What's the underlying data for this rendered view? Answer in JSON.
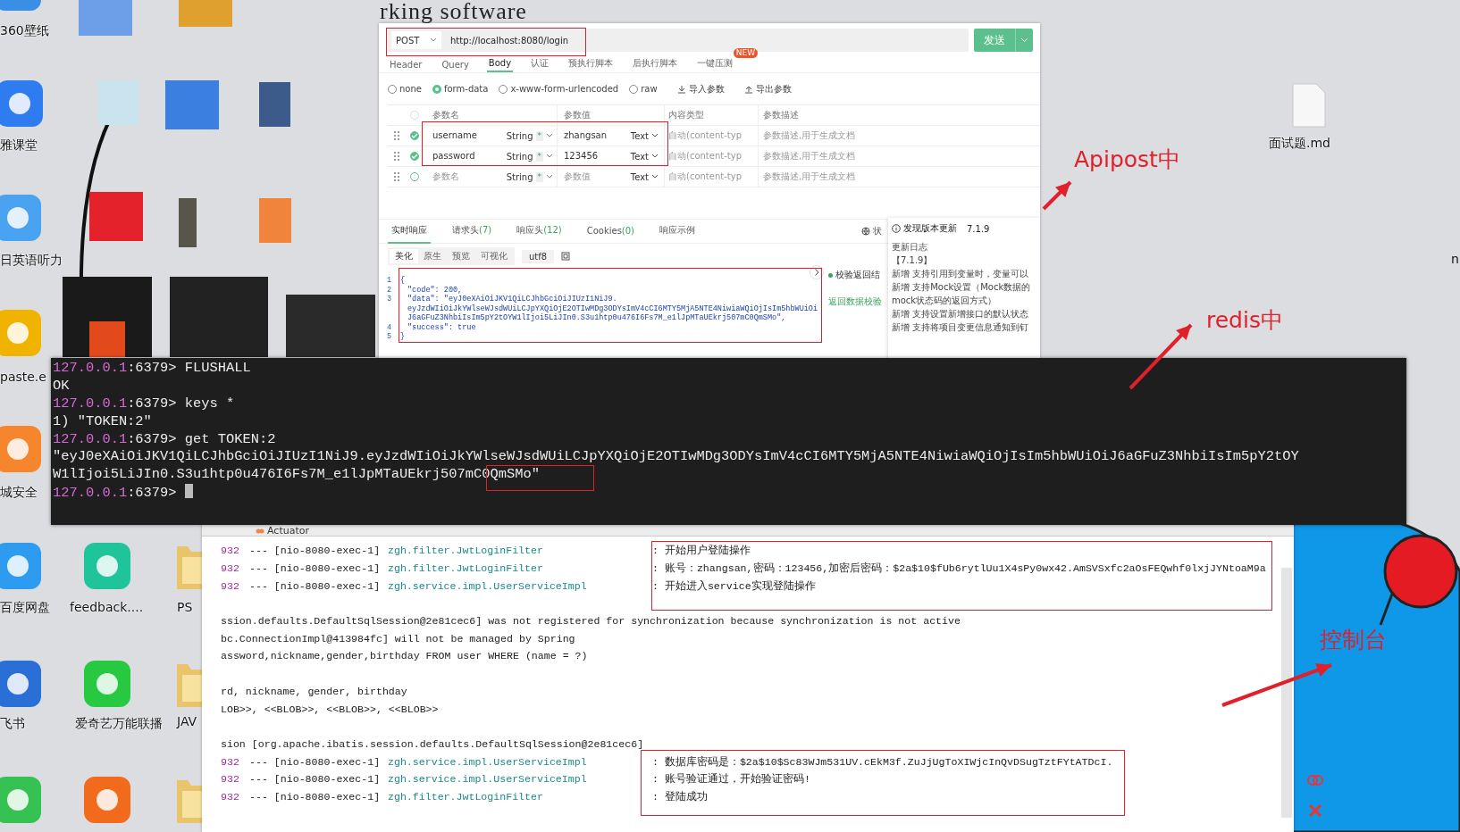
{
  "desktop": {
    "wallpaper_text": "rking software",
    "edge_text": "n",
    "icons": [
      {
        "kind": "app",
        "label": "360壁纸"
      },
      {
        "kind": "app",
        "label": "雅课堂"
      },
      {
        "kind": "app",
        "label": "日英语听力"
      },
      {
        "kind": "app",
        "label": "paste.e"
      },
      {
        "kind": "app",
        "label": "城安全"
      },
      {
        "kind": "app",
        "label": "百度网盘"
      },
      {
        "kind": "app",
        "label": "飞书"
      },
      {
        "kind": "app"
      },
      {
        "kind": "app",
        "label": "feedback...."
      },
      {
        "kind": "app",
        "label": "爱奇艺万能联播"
      },
      {
        "kind": "app"
      },
      {
        "kind": "folder",
        "label": "PS"
      },
      {
        "kind": "folder",
        "label": "JAV"
      },
      {
        "kind": "folder"
      },
      {
        "kind": "file",
        "label": "面试题.md"
      }
    ]
  },
  "annotations": [
    {
      "text": "Apipost中"
    },
    {
      "text": "redis中"
    },
    {
      "text": "控制台"
    }
  ],
  "apipost": {
    "method": "POST",
    "url": "http://localhost:8080/login",
    "send": "发送",
    "tabs": [
      {
        "label": "Header",
        "selected": false
      },
      {
        "label": "Query",
        "selected": false
      },
      {
        "label": "Body",
        "selected": true
      },
      {
        "label": "认证",
        "selected": false
      },
      {
        "label": "预执行脚本",
        "selected": false
      },
      {
        "label": "后执行脚本",
        "selected": false
      },
      {
        "label": "一键压测",
        "selected": false,
        "badge": "NEW"
      }
    ],
    "body_types": [
      {
        "label": "none",
        "selected": false
      },
      {
        "label": "form-data",
        "selected": true
      },
      {
        "label": "x-www-form-urlencoded",
        "selected": false
      },
      {
        "label": "raw",
        "selected": false
      }
    ],
    "actions": [
      {
        "label": "导入参数",
        "kind": "import"
      },
      {
        "label": "导出参数",
        "kind": "export"
      }
    ],
    "select_all": {
      "checked": false
    },
    "columns": [
      "参数名",
      "参数值",
      "内容类型",
      "参数描述"
    ],
    "rows": [
      {
        "checked": true,
        "name": "username",
        "type": "String",
        "required": "*",
        "value": "zhangsan",
        "content_type": "Text",
        "content_hint": "自动(content-typ",
        "description": "参数描述,用于生成文档"
      },
      {
        "checked": true,
        "name": "password",
        "type": "String",
        "required": "*",
        "value": "123456",
        "content_type": "Text",
        "content_hint": "自动(content-typ",
        "description": "参数描述,用于生成文档"
      },
      {
        "checked": false,
        "name_placeholder": "参数名",
        "type": "String",
        "required": "*",
        "value_placeholder": "参数值",
        "content_type": "Text",
        "content_hint": "自动(content-typ",
        "description": "参数描述,用于生成文档"
      }
    ],
    "response_tabs": [
      {
        "label": "实时响应",
        "selected": true
      },
      {
        "label": "请求头",
        "count": "(7)",
        "selected": false
      },
      {
        "label": "响应头",
        "count": "(12)",
        "selected": false
      },
      {
        "label": "Cookies",
        "count": "(0)",
        "selected": false
      },
      {
        "label": "响应示例",
        "selected": false
      }
    ],
    "status_label": "状",
    "view_tabs": [
      {
        "label": "美化",
        "selected": true
      },
      {
        "label": "原生",
        "selected": false
      },
      {
        "label": "预览",
        "selected": false
      },
      {
        "label": "可视化",
        "selected": false
      }
    ],
    "encoding": "utf8",
    "code_lines": [
      {
        "number": "1",
        "text": "{"
      },
      {
        "number": "2",
        "text": "\"code\": 200,"
      },
      {
        "number": "3",
        "text": "\"data\": \"eyJ0eXAiOiJKV1QiLCJhbGciOiJIUzI1NiJ9."
      },
      {
        "text": "eyJzdWIiOiJkYWlseWJsdWUiLCJpYXQiOjE2OTIwMDg3ODYsImV4cCI6MTY5MjA5NTE4NiwiaWQiOjIsIm5hbWUiOi"
      },
      {
        "text": "J6aGFuZ3NhbiIsIm5pY2tOYW1lIjoi5LiJIn0.S3u1htp0u476I6Fs7M_e1lJpMTaUEkrj507mC0QmSMo\","
      },
      {
        "number": "4",
        "text": "\"success\": true"
      },
      {
        "number": "5",
        "text": "}"
      }
    ],
    "validate_label": "校验返回结",
    "validate_link": "返回数据校验",
    "update": {
      "title": "发现版本更新",
      "version": "7.1.9",
      "log_title": "更新日志",
      "log_version": "【7.1.9】",
      "items": [
        "新增 支持引用到变量时，变量可以",
        "新增 支持Mock设置（Mock数据的",
        "mock状态码的返回方式）",
        "新增 支持设置新增接口的默认状态",
        "新增 支持将项目变更信息通知到钉"
      ]
    }
  },
  "terminal": {
    "lines": [
      {
        "kind": "prompt",
        "host": "127.0.0.1",
        "rest": ":6379> FLUSHALL"
      },
      {
        "kind": "output",
        "text": "OK"
      },
      {
        "kind": "prompt",
        "host": "127.0.0.1",
        "rest": ":6379> keys *"
      },
      {
        "kind": "output",
        "text": "1) \"TOKEN:2\""
      },
      {
        "kind": "prompt",
        "host": "127.0.0.1",
        "rest": ":6379> get TOKEN:2"
      },
      {
        "kind": "output",
        "text": "\"eyJ0eXAiOiJKV1QiLCJhbGciOiJIUzI1NiJ9.eyJzdWIiOiJkYWlseWJsdWUiLCJpYXQiOjE2OTIwMDg3ODYsImV4cCI6MTY5MjA5NTE4NiwiaWQiOjIsIm5hbWUiOiJ6aGFuZ3NhbiIsIm5pY2tOY"
      },
      {
        "kind": "output",
        "text": "W1lIjoi5LiJIn0.S3u1htp0u476I6Fs7M_e1lJpMTaUEkrj507mC0QmSMo\""
      },
      {
        "kind": "prompt",
        "host": "127.0.0.1",
        "rest": ":6379> ",
        "cursor": true
      }
    ]
  },
  "console": {
    "tab": "Actuator",
    "lines": [
      {
        "kind": "log",
        "pid": "932",
        "thread": "--- [nio-8080-exec-1]",
        "logger": "zgh.filter.JwtLoginFilter",
        "message": ": 开始用户登陆操作"
      },
      {
        "kind": "log",
        "pid": "932",
        "thread": "--- [nio-8080-exec-1]",
        "logger": "zgh.filter.JwtLoginFilter",
        "message": ": 账号：zhangsan,密码：123456,加密后密码：$2a$10$fUb6rytlUu1X4sPy0wx42.AmSVSxfc2aOsFEQwhf0lxjJYNtoaM9a"
      },
      {
        "kind": "log",
        "pid": "932",
        "thread": "--- [nio-8080-exec-1]",
        "logger": "zgh.service.impl.UserServiceImpl",
        "message": ": 开始进入service实现登陆操作"
      },
      {
        "kind": "plain",
        "gap_before": true,
        "text": "ssion.defaults.DefaultSqlSession@2e81cec6] was not registered for synchronization because synchronization is not active"
      },
      {
        "kind": "plain",
        "text": "bc.ConnectionImpl@413984fc] will not be managed by Spring"
      },
      {
        "kind": "plain",
        "text": "assword,nickname,gender,birthday FROM user WHERE (name = ?)"
      },
      {
        "kind": "plain",
        "gap_before": true,
        "text": "rd, nickname, gender, birthday"
      },
      {
        "kind": "plain",
        "text": "LOB>>, <<BLOB>>, <<BLOB>>, <<BLOB>>"
      },
      {
        "kind": "plain",
        "gap_before": true,
        "text": "sion [org.apache.ibatis.session.defaults.DefaultSqlSession@2e81cec6]"
      },
      {
        "kind": "log",
        "pid": "932",
        "thread": "--- [nio-8080-exec-1]",
        "logger": "zgh.service.impl.UserServiceImpl",
        "message": ": 数据库密码是：$2a$10$Sc83WJm531UV.cEkM3f.ZuJjUgToXIWjcInQvDSugTztFYtATDcI."
      },
      {
        "kind": "log",
        "pid": "932",
        "thread": "--- [nio-8080-exec-1]",
        "logger": "zgh.service.impl.UserServiceImpl",
        "message": ": 账号验证通过，开始验证密码!"
      },
      {
        "kind": "log",
        "pid": "932",
        "thread": "--- [nio-8080-exec-1]",
        "logger": "zgh.filter.JwtLoginFilter",
        "message": ": 登陆成功"
      }
    ]
  }
}
